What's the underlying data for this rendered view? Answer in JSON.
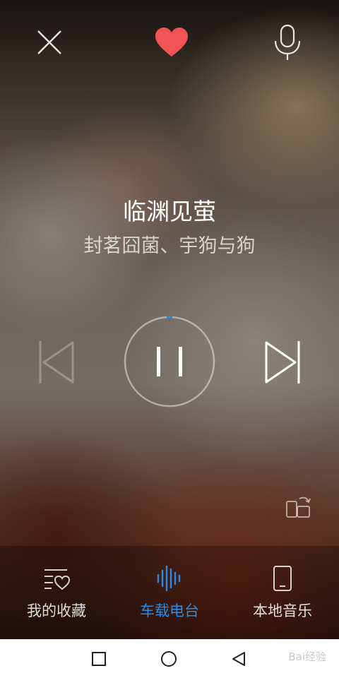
{
  "header": {
    "close_icon": "close-icon",
    "favorite_icon": "heart-icon",
    "favorite_color": "#f05454",
    "voice_icon": "microphone-icon"
  },
  "song": {
    "title": "临渊见萤",
    "artist": "封茗囧菌、宇狗与狗"
  },
  "controls": {
    "previous_icon": "skip-previous-icon",
    "play_state": "playing",
    "pause_icon": "pause-icon",
    "next_icon": "skip-next-icon",
    "progress": 0.02,
    "progress_color": "#2b8ae6",
    "switch_device_icon": "device-switch-icon"
  },
  "tabs": [
    {
      "label": "我的收藏",
      "icon": "favorites-list-icon",
      "active": false
    },
    {
      "label": "车载电台",
      "icon": "sound-wave-icon",
      "active": true
    },
    {
      "label": "本地音乐",
      "icon": "phone-icon",
      "active": false
    }
  ],
  "accent_color": "#2b8ae6",
  "system_nav": {
    "items": [
      "recents-square-icon",
      "home-circle-icon",
      "back-triangle-icon"
    ],
    "watermark": "Bai经验"
  }
}
